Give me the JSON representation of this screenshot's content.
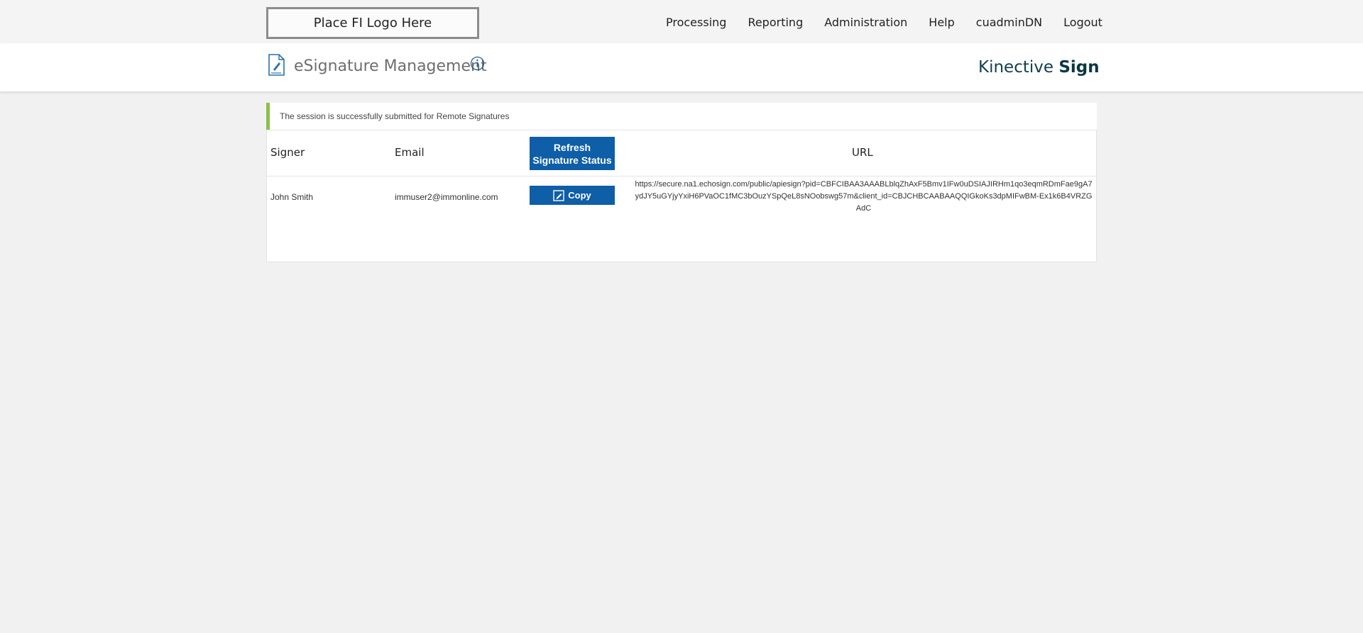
{
  "topbar": {
    "logo_text": "Place FI Logo Here",
    "nav": {
      "processing": "Processing",
      "reporting": "Reporting",
      "administration": "Administration",
      "help": "Help",
      "user": "cuadminDN",
      "logout": "Logout"
    }
  },
  "titlebar": {
    "icon": "document-signature-icon",
    "info_icon": "info-icon",
    "title": "eSignature Management",
    "brand_light": "Kinective",
    "brand_bold": "Sign"
  },
  "banner": {
    "message": "The session is successfully submitted for Remote Signatures",
    "accent_color": "#8ac149"
  },
  "table": {
    "headers": {
      "signer": "Signer",
      "email": "Email",
      "refresh_button": "Refresh Signature Status",
      "url": "URL"
    },
    "rows": [
      {
        "signer": "John Smith",
        "email": "immuser2@immonline.com",
        "copy_button": "Copy",
        "url": "https://secure.na1.echosign.com/public/apiesign?pid=CBFCIBAA3AAABLblqZhAxF5Bmv1IFw0uDSIAJIRHm1qo3eqmRDmFae9gA7ydJY5uGYjyYxiH6PVaOC1fMC3bOuzYSpQeL8sNOobswg57m&client_id=CBJCHBCAABAAQQIGkoKs3dpMIFwBM-Ex1k6B4VRZGAdC"
      }
    ]
  },
  "colors": {
    "button_blue": "#0e5ea8",
    "brand_text": "#123f4a",
    "page_bg": "#f1f1f1"
  }
}
